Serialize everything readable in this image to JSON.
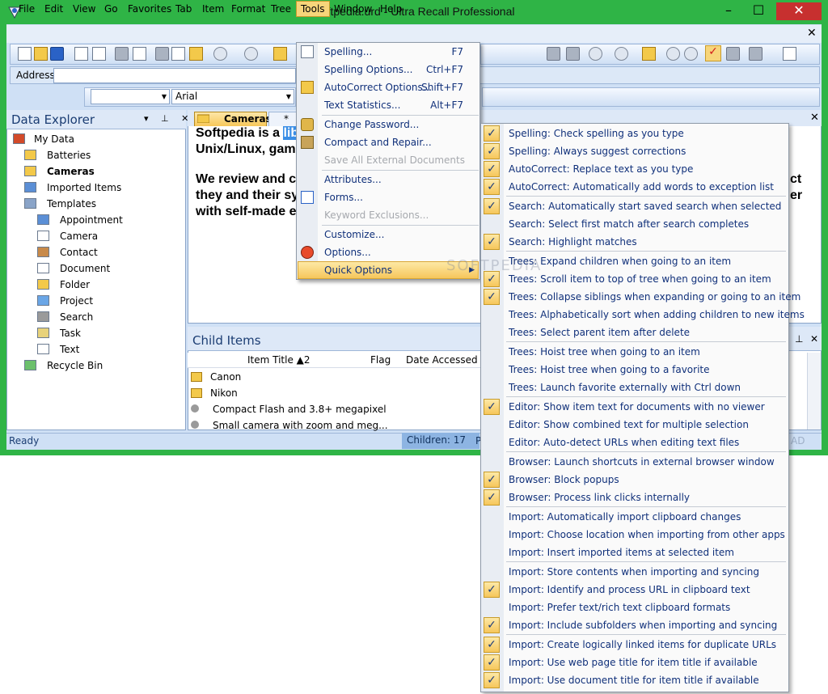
{
  "window": {
    "title": "Softpedia.urd - Ultra Recall Professional",
    "min": "–",
    "max": "☐",
    "close": "✕",
    "mdi_close": "✕"
  },
  "menubar": [
    "File",
    "Edit",
    "View",
    "Go",
    "Favorites",
    "Tab",
    "Item",
    "Format",
    "Tree",
    "Tools",
    "Window",
    "Help"
  ],
  "address": {
    "label": "Address",
    "value": ""
  },
  "format": {
    "style": "",
    "font": "Arial"
  },
  "data_explorer": {
    "title": "Data Explorer",
    "buttons": "▾ ⊥ ✕",
    "tree": [
      {
        "label": "My Data",
        "level": 0,
        "icon": "home-icon"
      },
      {
        "label": "Batteries",
        "level": 1,
        "icon": "folder-icon"
      },
      {
        "label": "Cameras",
        "level": 1,
        "icon": "folder-icon",
        "selected": true
      },
      {
        "label": "Imported Items",
        "level": 1,
        "icon": "imported-icon"
      },
      {
        "label": "Templates",
        "level": 1,
        "icon": "templates-icon"
      },
      {
        "label": "Appointment",
        "level": 2,
        "icon": "calendar-icon"
      },
      {
        "label": "Camera",
        "level": 2,
        "icon": "document-icon"
      },
      {
        "label": "Contact",
        "level": 2,
        "icon": "contact-icon"
      },
      {
        "label": "Document",
        "level": 2,
        "icon": "document-icon"
      },
      {
        "label": "Folder",
        "level": 2,
        "icon": "folder-icon"
      },
      {
        "label": "Project",
        "level": 2,
        "icon": "project-icon"
      },
      {
        "label": "Search",
        "level": 2,
        "icon": "search-icon"
      },
      {
        "label": "Task",
        "level": 2,
        "icon": "task-icon"
      },
      {
        "label": "Text",
        "level": 2,
        "icon": "text-icon"
      },
      {
        "label": "Recycle Bin",
        "level": 1,
        "icon": "recycle-bin-icon"
      }
    ]
  },
  "editor": {
    "tab_active": "Cameras",
    "tab_second": "* C",
    "close": "✕",
    "line1_pre": "Softpedia is a ",
    "line1_sel": "lib",
    "line2": "Unix/Linux, gam",
    "line3_pre": "We review and c",
    "line3_post": "ct",
    "line4_pre": "they and their sy",
    "line4_post": "er",
    "line5": "with self-made e"
  },
  "child_items": {
    "title": "Child Items",
    "columns": [
      "Item Title ▲2",
      "Flag",
      "Date Accessed"
    ],
    "rows": [
      "Canon",
      "Nikon",
      "Compact Flash and 3.8+ megapixel",
      "Small camera with zoom and meg..."
    ],
    "pin": "⊥",
    "close": "✕"
  },
  "status": {
    "ready": "Ready",
    "children": "Children: 17",
    "p": "P",
    "ad": "AD"
  },
  "tools_menu": [
    {
      "label": "Spelling...",
      "shortcut": "F7",
      "icon": "spelling-icon"
    },
    {
      "label": "Spelling Options...",
      "shortcut": "Ctrl+F7"
    },
    {
      "label": "AutoCorrect Options...",
      "shortcut": "Shift+F7",
      "icon": "autocorrect-icon"
    },
    {
      "label": "Text Statistics...",
      "shortcut": "Alt+F7"
    },
    {
      "separator": true
    },
    {
      "label": "Change Password...",
      "icon": "lock-icon"
    },
    {
      "label": "Compact and Repair...",
      "icon": "wrench-icon"
    },
    {
      "label": "Save All External Documents",
      "disabled": true
    },
    {
      "separator": true
    },
    {
      "label": "Attributes..."
    },
    {
      "label": "Forms...",
      "icon": "form-icon"
    },
    {
      "label": "Keyword Exclusions...",
      "disabled": true
    },
    {
      "separator": true
    },
    {
      "label": "Customize..."
    },
    {
      "label": "Options...",
      "icon": "options-icon"
    },
    {
      "label": "Quick Options",
      "submenu": true,
      "highlight": true
    }
  ],
  "quick_options": [
    {
      "label": "Spelling: Check spelling as you type",
      "checked": true
    },
    {
      "label": "Spelling: Always suggest corrections",
      "checked": true
    },
    {
      "label": "AutoCorrect: Replace text as you type",
      "checked": true
    },
    {
      "label": "AutoCorrect: Automatically add words to exception list",
      "checked": true
    },
    {
      "separator": true
    },
    {
      "label": "Search: Automatically start saved search when selected",
      "checked": true
    },
    {
      "label": "Search: Select first match after search completes",
      "checked": false
    },
    {
      "label": "Search: Highlight matches",
      "checked": true
    },
    {
      "separator": true
    },
    {
      "label": "Trees: Expand children when going to an item",
      "checked": false
    },
    {
      "label": "Trees: Scroll item to top of tree when going to an item",
      "checked": true
    },
    {
      "label": "Trees: Collapse siblings when expanding or going to an item",
      "checked": true
    },
    {
      "label": "Trees: Alphabetically sort when adding children to new items",
      "checked": false
    },
    {
      "label": "Trees: Select parent item after delete",
      "checked": false
    },
    {
      "separator": true
    },
    {
      "label": "Trees: Hoist tree when going to an item",
      "checked": false
    },
    {
      "label": "Trees: Hoist tree when going to a favorite",
      "checked": false
    },
    {
      "label": "Trees: Launch favorite externally with Ctrl down",
      "checked": false
    },
    {
      "separator": true
    },
    {
      "label": "Editor: Show item text for documents with no viewer",
      "checked": true
    },
    {
      "label": "Editor: Show combined text for multiple selection",
      "checked": false
    },
    {
      "label": "Editor: Auto-detect URLs when editing text files",
      "checked": false
    },
    {
      "separator": true
    },
    {
      "label": "Browser: Launch shortcuts in external browser window",
      "checked": false
    },
    {
      "label": "Browser: Block popups",
      "checked": true
    },
    {
      "label": "Browser: Process link clicks internally",
      "checked": true
    },
    {
      "separator": true
    },
    {
      "label": "Import: Automatically import clipboard changes",
      "checked": false
    },
    {
      "label": "Import: Choose location when importing from other apps",
      "checked": false
    },
    {
      "label": "Import: Insert imported items at selected item",
      "checked": false
    },
    {
      "separator": true
    },
    {
      "label": "Import: Store contents when importing and syncing",
      "checked": false
    },
    {
      "label": "Import: Identify and process URL in clipboard text",
      "checked": true
    },
    {
      "label": "Import: Prefer text/rich text clipboard formats",
      "checked": false
    },
    {
      "label": "Import: Include subfolders when importing and syncing",
      "checked": true
    },
    {
      "separator": true
    },
    {
      "label": "Import: Create logically linked items for duplicate URLs",
      "checked": true
    },
    {
      "label": "Import: Use web page title for item title if available",
      "checked": true
    },
    {
      "label": "Import: Use document title for item title if available",
      "checked": true
    }
  ],
  "check_glyph": "✓",
  "watermark": "SOFTPEDIA"
}
